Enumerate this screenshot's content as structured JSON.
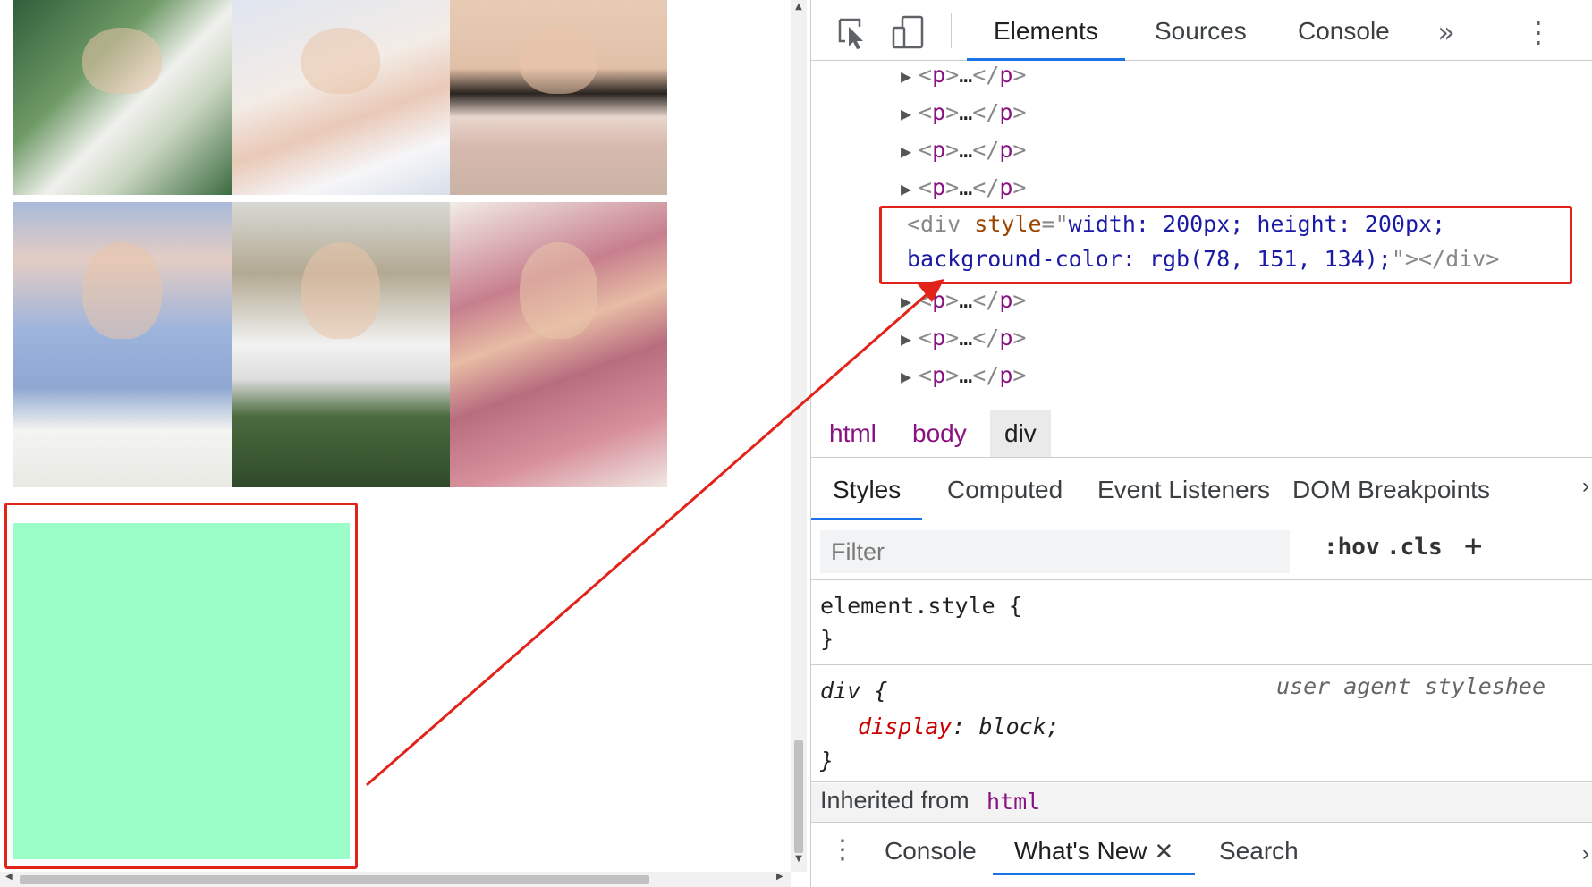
{
  "viewport": {
    "photos": [
      "photo-1",
      "photo-2",
      "photo-3",
      "photo-4",
      "photo-5",
      "photo-6"
    ],
    "green_box_color": "#9bfdc7",
    "highlight_color": "#e2231a"
  },
  "toolbar": {
    "inspect_icon": "cursor-arrow-icon",
    "device_icon": "device-toggle-icon",
    "tabs": [
      "Elements",
      "Sources",
      "Console"
    ],
    "more_icon": "double-chevron-right-icon",
    "menu_icon": "vertical-dots-icon",
    "accent": "#1a73e8"
  },
  "dom_tree": {
    "collapsed_p": {
      "open": "<",
      "tag": "p",
      "close": ">",
      "ellipsis": "…",
      "end_open": "</",
      "end_close": ">"
    },
    "selected": {
      "tag_open": "<div",
      "attr_name": "style",
      "eq": "=\"",
      "line1_value": "width: 200px; height: 200px;",
      "line2_value": "background-color: rgb(78, 151, 134);",
      "close_quote": "\"",
      "tag_end": "></div>"
    }
  },
  "breadcrumb": {
    "items": [
      "html",
      "body",
      "div"
    ]
  },
  "styles_tabs": [
    "Styles",
    "Computed",
    "Event Listeners",
    "DOM Breakpoints"
  ],
  "filter": {
    "placeholder": "Filter",
    "hov": ":hov",
    "cls": ".cls",
    "add": "+"
  },
  "rules": {
    "element_style": {
      "selector": "element.style {",
      "close": "}"
    },
    "div_rule": {
      "selector": "div {",
      "source": "user agent styleshee",
      "prop": "display",
      "colon": ":",
      "value": "block;",
      "close": "}"
    },
    "inherited": {
      "label": "Inherited from",
      "tag": "html"
    }
  },
  "drawer": {
    "menu_icon": "vertical-dots-icon",
    "tabs": [
      "Console",
      "What's New",
      "Search"
    ],
    "close": "✕"
  }
}
